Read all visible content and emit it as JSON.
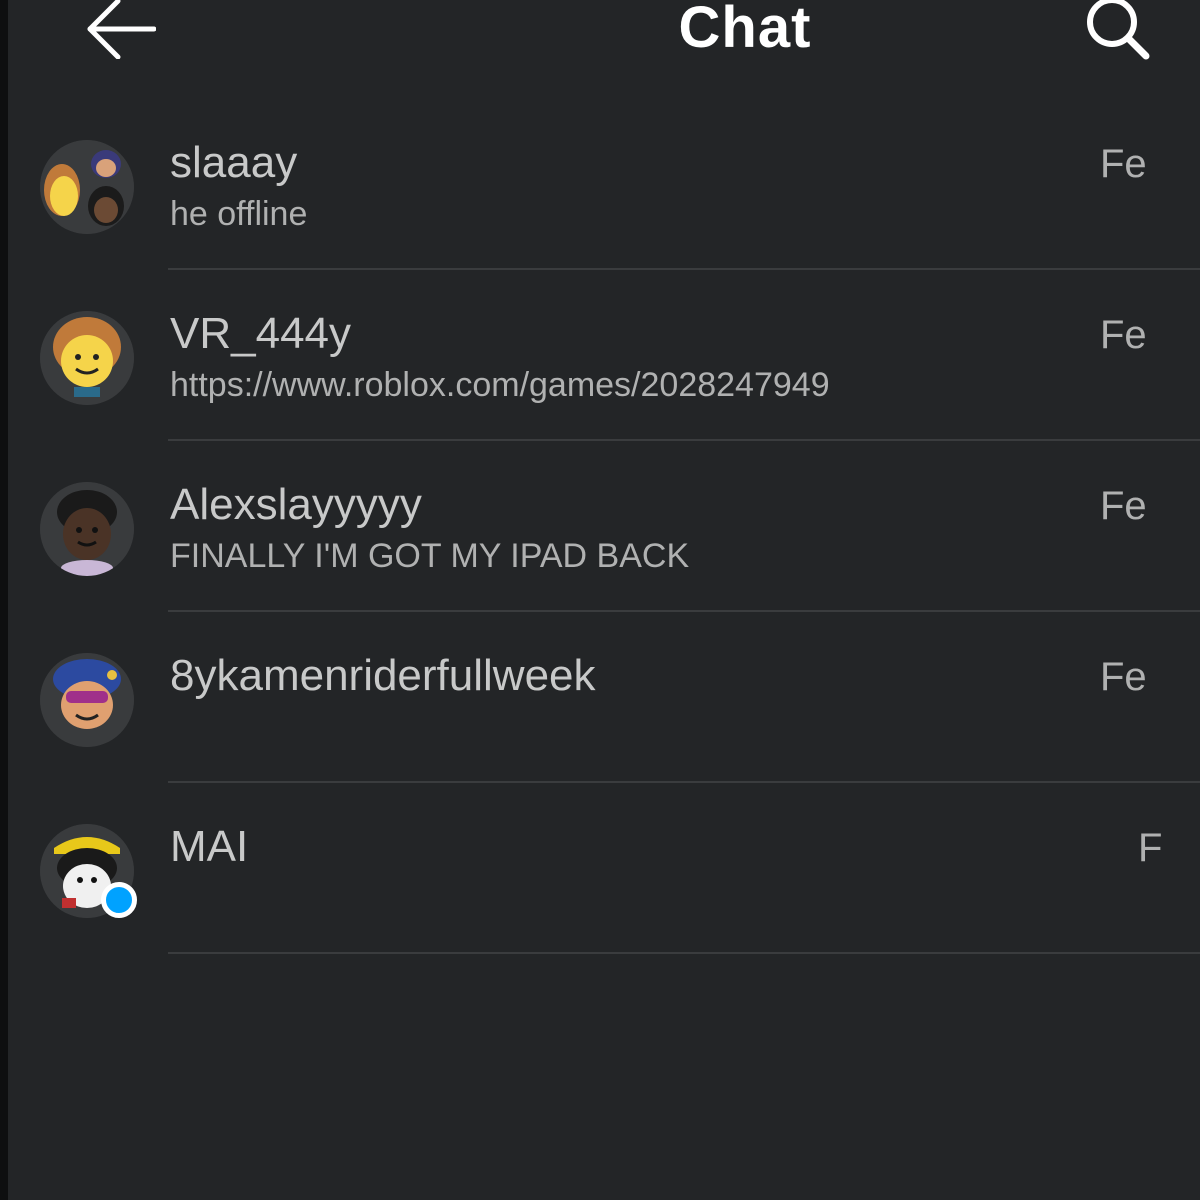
{
  "header": {
    "title": "Chat",
    "back_icon": "arrow-left-icon",
    "search_icon": "search-icon"
  },
  "colors": {
    "background": "#232527",
    "text_primary": "#c8c9c9",
    "text_secondary": "#b0b1b1",
    "divider": "#3a3c3e",
    "online_dot": "#00a2ff"
  },
  "conversations": [
    {
      "name": "slaaay",
      "preview": "he offline",
      "date": "Fe",
      "avatar": "group-avatar",
      "online": false
    },
    {
      "name": "VR_444y",
      "preview": "https://www.roblox.com/games/2028247949",
      "date": "Fe",
      "avatar": "user-avatar",
      "online": false
    },
    {
      "name": "Alexslayyyyy",
      "preview": "FINALLY I'M GOT MY IPAD BACK",
      "date": "Fe",
      "avatar": "user-avatar",
      "online": false
    },
    {
      "name": "8ykamenriderfullweek",
      "preview": "",
      "date": "Fe",
      "avatar": "user-avatar",
      "online": false
    },
    {
      "name": "MAI",
      "preview": "",
      "date": "F",
      "avatar": "user-avatar",
      "online": true
    }
  ]
}
